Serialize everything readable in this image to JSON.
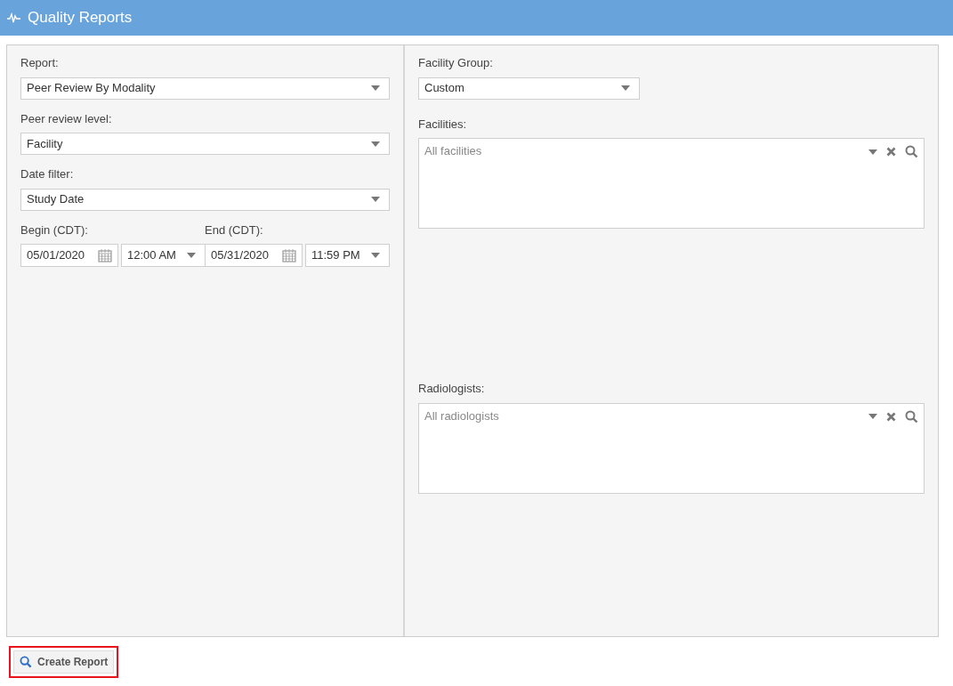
{
  "header": {
    "title": "Quality Reports"
  },
  "left": {
    "report": {
      "label": "Report:",
      "value": "Peer Review By Modality"
    },
    "level": {
      "label": "Peer review level:",
      "value": "Facility"
    },
    "date_filter": {
      "label": "Date filter:",
      "value": "Study Date"
    },
    "begin": {
      "label": "Begin (CDT):",
      "date": "05/01/2020",
      "time": "12:00 AM"
    },
    "end": {
      "label": "End (CDT):",
      "date": "05/31/2020",
      "time": "11:59 PM"
    }
  },
  "right": {
    "facility_group": {
      "label": "Facility Group:",
      "value": "Custom"
    },
    "facilities": {
      "label": "Facilities:",
      "placeholder": "All facilities"
    },
    "radiologists": {
      "label": "Radiologists:",
      "placeholder": "All radiologists"
    }
  },
  "create_button": {
    "label": "Create Report",
    "highlighted": true
  }
}
